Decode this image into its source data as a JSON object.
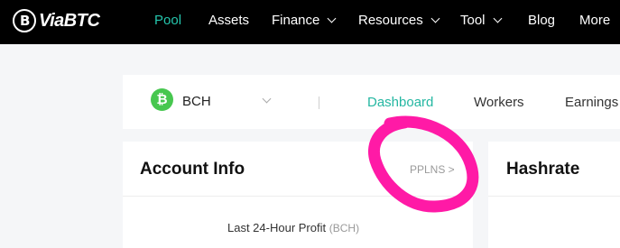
{
  "brand": {
    "name": "ViaBTC"
  },
  "nav": {
    "pool": "Pool",
    "assets": "Assets",
    "finance": "Finance",
    "resources": "Resources",
    "tool": "Tool",
    "blog": "Blog",
    "more": "More"
  },
  "coin_selector": {
    "selected": "BCH",
    "icon_glyph": "₿"
  },
  "tabs": {
    "dashboard": "Dashboard",
    "workers": "Workers",
    "earnings": "Earnings"
  },
  "account_card": {
    "title": "Account Info",
    "mode_link": "PPLNS >",
    "profit_label": "Last 24-Hour Profit",
    "profit_unit": "(BCH)"
  },
  "hashrate_card": {
    "title": "Hashrate"
  },
  "colors": {
    "accent": "#25c6ad",
    "annotation": "#ff1aa6",
    "coin": "#47c74f"
  }
}
